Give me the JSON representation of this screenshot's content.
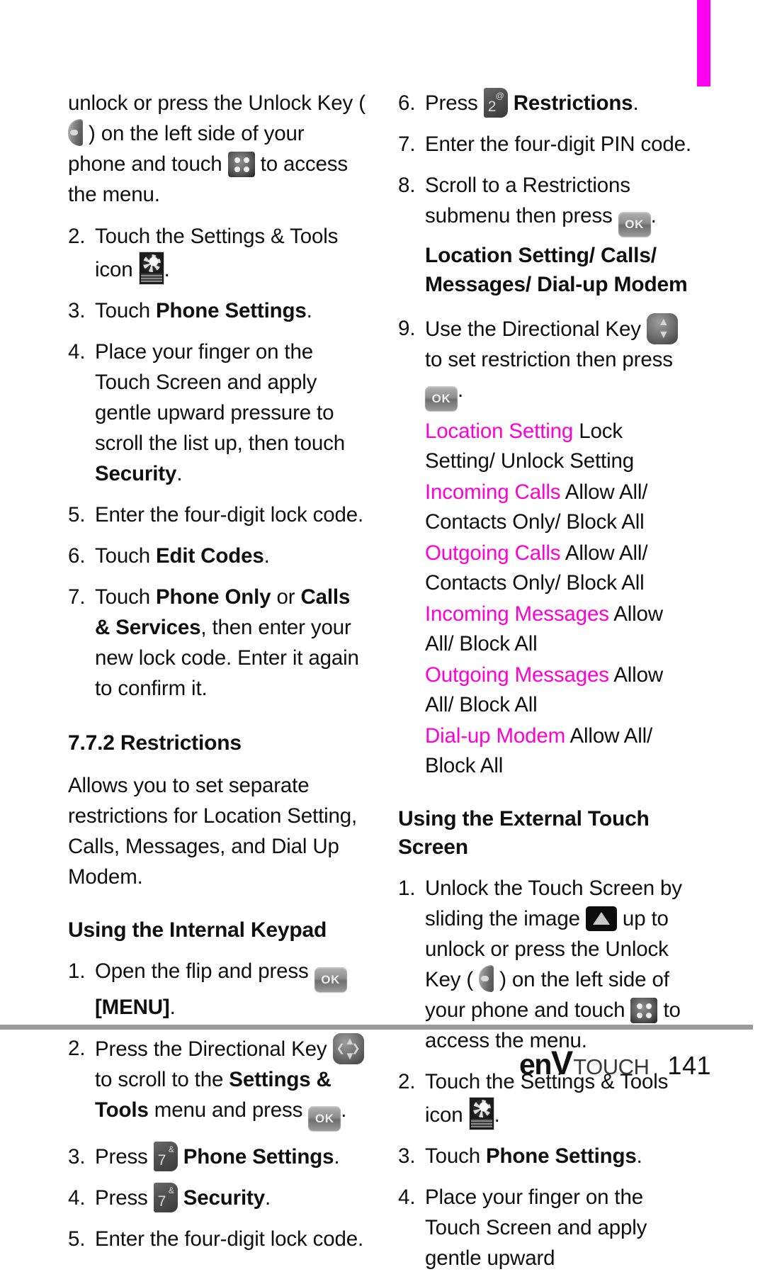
{
  "page": {
    "number": "141",
    "brand_env": "en",
    "brand_v": "V",
    "brand_touch": "TOUCH",
    "tab_color": "#ff00f0",
    "accent_color": "#ff00d4"
  },
  "left_column": {
    "step1_cont": {
      "part1": "unlock or press the Unlock Key",
      "part2": "( ",
      "part3": " ) on the left side of your phone and touch ",
      "part4": " to access the menu."
    },
    "step2": {
      "num": "2.",
      "text_before": "Touch the Settings & Tools icon ",
      "text_after": "."
    },
    "step3": {
      "num": "3.",
      "text_before": "Touch ",
      "bold": "Phone Settings",
      "text_after": "."
    },
    "step4": {
      "num": "4.",
      "text_before": "Place your finger on the Touch Screen and apply gentle upward pressure to scroll the list up, then touch ",
      "bold": "Security",
      "text_after": "."
    },
    "step5": {
      "num": "5.",
      "text": "Enter the four-digit lock code."
    },
    "step6": {
      "num": "6.",
      "text_before": "Touch ",
      "bold": "Edit Codes",
      "text_after": "."
    },
    "step7": {
      "num": "7.",
      "text_before": "Touch ",
      "bold1": "Phone Only",
      "text_mid": " or ",
      "bold2": "Calls & Services",
      "text_after": ", then enter your new lock code. Enter it again to confirm it."
    },
    "section_heading": "7.7.2 Restrictions",
    "section_body": "Allows you to set separate restrictions for Location Setting, Calls, Messages, and Dial Up Modem.",
    "subheading": "Using the Internal Keypad",
    "kp_step1": {
      "num": "1.",
      "text_before": "Open the flip and press ",
      "bold_after": "[MENU]",
      "text_end": "."
    },
    "kp_step2": {
      "num": "2.",
      "text_before": "Press the Directional Key ",
      "text_mid": " to scroll to the ",
      "bold": "Settings & Tools",
      "text_after2": " menu and press ",
      "text_end": "."
    },
    "kp_step3": {
      "num": "3.",
      "text_before": "Press ",
      "key_digit": "7",
      "key_sup": "&",
      "bold": "Phone Settings",
      "text_after": "."
    },
    "kp_step4": {
      "num": "4.",
      "text_before": "Press ",
      "key_digit": "7",
      "key_sup": "&",
      "bold": "Security",
      "text_after": "."
    },
    "kp_step5": {
      "num": "5.",
      "text": "Enter the four-digit lock code."
    }
  },
  "right_column": {
    "kp_step6": {
      "num": "6.",
      "text_before": "Press ",
      "key_digit": "2",
      "key_sup": "@",
      "bold": "Restrictions",
      "text_after": "."
    },
    "kp_step7": {
      "num": "7.",
      "text": "Enter the four-digit PIN code."
    },
    "kp_step8": {
      "num": "8.",
      "text_before": "Scroll to a Restrictions submenu then press ",
      "text_after": "."
    },
    "submenu_heading": "Location Setting/ Calls/ Messages/ Dial-up Modem",
    "kp_step9": {
      "num": "9.",
      "text_before": "Use the Directional Key ",
      "text_mid": " to set restriction then press ",
      "text_after": "."
    },
    "options": [
      {
        "key": "Location Setting",
        "value": "Lock Setting/ Unlock Setting"
      },
      {
        "key": "Incoming Calls",
        "value": "Allow All/ Contacts Only/ Block All"
      },
      {
        "key": "Outgoing Calls",
        "value": "Allow All/ Contacts Only/ Block All"
      },
      {
        "key": "Incoming Messages",
        "value": "Allow All/ Block All"
      },
      {
        "key": "Outgoing Messages",
        "value": "Allow All/ Block All"
      },
      {
        "key": "Dial-up Modem",
        "value": "Allow All/ Block All"
      }
    ],
    "subheading": "Using the External Touch Screen",
    "ts_step1": {
      "num": "1.",
      "text_before": "Unlock the Touch Screen by sliding the image ",
      "text_mid": " up to unlock or press the Unlock Key ( ",
      "text_mid2": " ) on the left side of your phone and touch ",
      "text_after": " to access the menu."
    },
    "ts_step2": {
      "num": "2.",
      "text_before": "Touch the Settings & Tools icon ",
      "text_after": "."
    },
    "ts_step3": {
      "num": "3.",
      "text_before": "Touch ",
      "bold": "Phone Settings",
      "text_after": "."
    },
    "ts_step4": {
      "num": "4.",
      "text": "Place your finger on the Touch Screen and apply gentle upward"
    }
  },
  "icons": {
    "unlock_key": "unlock-key-icon",
    "menu_dots": "menu-dots-icon",
    "settings_tools": "settings-and-tools-icon",
    "ok_key": "ok-key-icon",
    "ok_label": "OK",
    "dpad": "directional-key-icon",
    "updown": "up-down-directional-key-icon",
    "slide_unlock": "slide-to-unlock-icon"
  }
}
